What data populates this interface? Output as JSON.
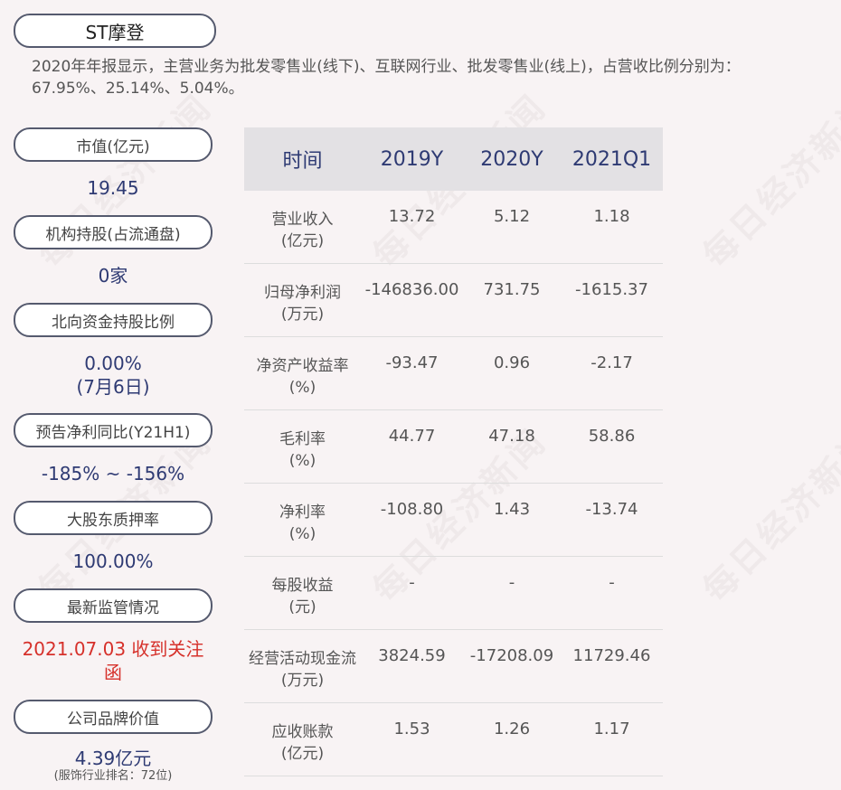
{
  "title": "ST摩登",
  "summary": "2020年年报显示，主营业务为批发零售业(线下)、互联网行业、批发零售业(线上)，占营收比例分别为：67.95%、25.14%、5.04%。",
  "watermark": "每日经济新闻",
  "metrics": [
    {
      "label": "市值(亿元)",
      "value": "19.45"
    },
    {
      "label": "机构持股(占流通盘)",
      "value": "0家"
    },
    {
      "label": "北向资金持股比例",
      "value": "0.00%",
      "value2": "(7月6日)"
    },
    {
      "label": "预告净利同比(Y21H1)",
      "value": "-185% ~ -156%"
    },
    {
      "label": "大股东质押率",
      "value": "100.00%"
    },
    {
      "label": "最新监管情况",
      "value": "2021.07.03 收到关注函"
    },
    {
      "label": "公司品牌价值",
      "value": "4.39亿元",
      "sub": "(服饰行业排名：72位)"
    }
  ],
  "table": {
    "headers": [
      "时间",
      "2019Y",
      "2020Y",
      "2021Q1"
    ],
    "rows": [
      {
        "label": "营业收入",
        "unit": "(亿元)",
        "values": [
          "13.72",
          "5.12",
          "1.18"
        ]
      },
      {
        "label": "归母净利润",
        "unit": "(万元)",
        "values": [
          "-146836.00",
          "731.75",
          "-1615.37"
        ]
      },
      {
        "label": "净资产收益率",
        "unit": "(%)",
        "values": [
          "-93.47",
          "0.96",
          "-2.17"
        ]
      },
      {
        "label": "毛利率",
        "unit": "(%)",
        "values": [
          "44.77",
          "47.18",
          "58.86"
        ]
      },
      {
        "label": "净利率",
        "unit": "(%)",
        "values": [
          "-108.80",
          "1.43",
          "-13.74"
        ]
      },
      {
        "label": "每股收益",
        "unit": "(元)",
        "values": [
          "-",
          "-",
          "-"
        ]
      },
      {
        "label": "经营活动现金流",
        "unit": "(万元)",
        "values": [
          "3824.59",
          "-17208.09",
          "11729.46"
        ]
      },
      {
        "label": "应收账款",
        "unit": "(亿元)",
        "values": [
          "1.53",
          "1.26",
          "1.17"
        ]
      }
    ]
  }
}
